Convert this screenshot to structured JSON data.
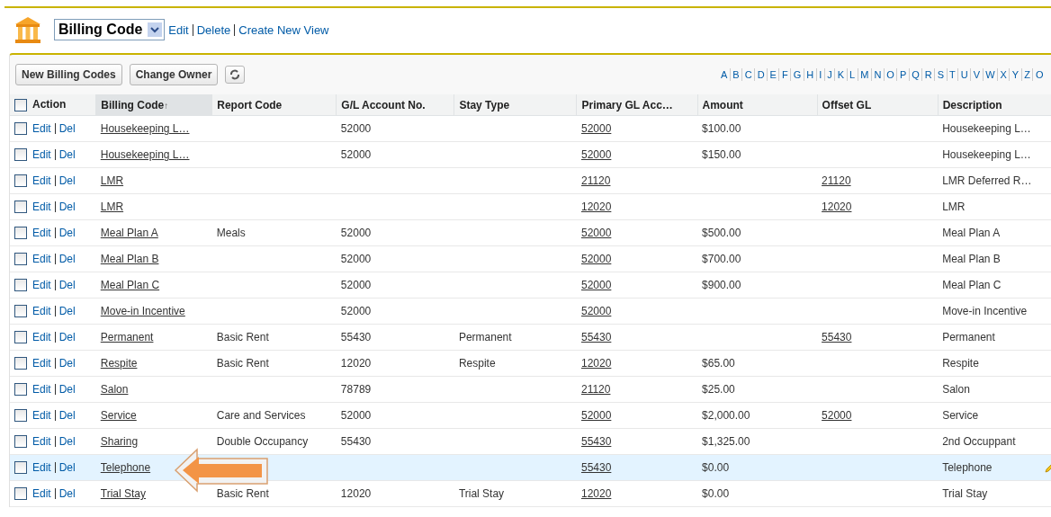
{
  "view": {
    "selected_view": "Billing Code",
    "links": [
      "Edit",
      "Delete",
      "Create New View"
    ]
  },
  "toolbar": {
    "buttons": [
      "New Billing Codes",
      "Change Owner"
    ],
    "alphabet": [
      "A",
      "B",
      "C",
      "D",
      "E",
      "F",
      "G",
      "H",
      "I",
      "J",
      "K",
      "L",
      "M",
      "N",
      "O",
      "P",
      "Q",
      "R",
      "S",
      "T",
      "U",
      "V",
      "W",
      "X",
      "Y",
      "Z",
      "O"
    ]
  },
  "table": {
    "action_label": "Action",
    "all_checked": false,
    "sort_mark": "↑",
    "columns": [
      {
        "label": "Billing Code",
        "kind": "link",
        "sorted": true
      },
      {
        "label": "Report Code",
        "kind": "text",
        "sorted": false
      },
      {
        "label": "G/L Account No.",
        "kind": "text",
        "sorted": false
      },
      {
        "label": "Stay Type",
        "kind": "text",
        "sorted": false
      },
      {
        "label": "Primary GL Acc…",
        "kind": "link",
        "sorted": false
      },
      {
        "label": "Amount",
        "kind": "text",
        "sorted": false
      },
      {
        "label": "Offset GL",
        "kind": "link",
        "sorted": false
      },
      {
        "label": "Description",
        "kind": "text",
        "sorted": false
      }
    ],
    "rows": [
      {
        "checked": false,
        "selected": false,
        "actions": [
          "Edit",
          "Del"
        ],
        "cells": [
          "Housekeeping L…",
          "",
          "52000",
          "",
          "52000",
          "$100.00",
          "",
          "Housekeeping L…"
        ]
      },
      {
        "checked": false,
        "selected": false,
        "actions": [
          "Edit",
          "Del"
        ],
        "cells": [
          "Housekeeping L…",
          "",
          "52000",
          "",
          "52000",
          "$150.00",
          "",
          "Housekeeping L…"
        ]
      },
      {
        "checked": false,
        "selected": false,
        "actions": [
          "Edit",
          "Del"
        ],
        "cells": [
          "LMR",
          "",
          "",
          "",
          "21120",
          "",
          "21120",
          "LMR Deferred R…"
        ]
      },
      {
        "checked": false,
        "selected": false,
        "actions": [
          "Edit",
          "Del"
        ],
        "cells": [
          "LMR",
          "",
          "",
          "",
          "12020",
          "",
          "12020",
          "LMR"
        ]
      },
      {
        "checked": false,
        "selected": false,
        "actions": [
          "Edit",
          "Del"
        ],
        "cells": [
          "Meal Plan A",
          "Meals",
          "52000",
          "",
          "52000",
          "$500.00",
          "",
          "Meal Plan A"
        ]
      },
      {
        "checked": false,
        "selected": false,
        "actions": [
          "Edit",
          "Del"
        ],
        "cells": [
          "Meal Plan B",
          "",
          "52000",
          "",
          "52000",
          "$700.00",
          "",
          "Meal Plan B"
        ]
      },
      {
        "checked": false,
        "selected": false,
        "actions": [
          "Edit",
          "Del"
        ],
        "cells": [
          "Meal Plan C",
          "",
          "52000",
          "",
          "52000",
          "$900.00",
          "",
          "Meal Plan C"
        ]
      },
      {
        "checked": false,
        "selected": false,
        "actions": [
          "Edit",
          "Del"
        ],
        "cells": [
          "Move-in Incentive",
          "",
          "52000",
          "",
          "52000",
          "",
          "",
          "Move-in Incentive"
        ]
      },
      {
        "checked": false,
        "selected": false,
        "actions": [
          "Edit",
          "Del"
        ],
        "cells": [
          "Permanent",
          "Basic Rent",
          "55430",
          "Permanent",
          "55430",
          "",
          "55430",
          "Permanent"
        ]
      },
      {
        "checked": false,
        "selected": false,
        "actions": [
          "Edit",
          "Del"
        ],
        "cells": [
          "Respite",
          "Basic Rent",
          "12020",
          "Respite",
          "12020",
          "$65.00",
          "",
          "Respite"
        ]
      },
      {
        "checked": false,
        "selected": false,
        "actions": [
          "Edit",
          "Del"
        ],
        "cells": [
          "Salon",
          "",
          "78789",
          "",
          "21120",
          "$25.00",
          "",
          "Salon"
        ]
      },
      {
        "checked": false,
        "selected": false,
        "actions": [
          "Edit",
          "Del"
        ],
        "cells": [
          "Service",
          "Care and Services",
          "52000",
          "",
          "52000",
          "$2,000.00",
          "52000",
          "Service"
        ]
      },
      {
        "checked": false,
        "selected": false,
        "actions": [
          "Edit",
          "Del"
        ],
        "cells": [
          "Sharing",
          "Double Occupancy",
          "55430",
          "",
          "55430",
          "$1,325.00",
          "",
          "2nd Occuppant"
        ]
      },
      {
        "checked": false,
        "selected": true,
        "actions": [
          "Edit",
          "Del"
        ],
        "cells": [
          "Telephone",
          "",
          "",
          "",
          "55430",
          "$0.00",
          "",
          "Telephone"
        ]
      },
      {
        "checked": false,
        "selected": false,
        "actions": [
          "Edit",
          "Del"
        ],
        "cells": [
          "Trial Stay",
          "Basic Rent",
          "12020",
          "Trial Stay",
          "12020",
          "$0.00",
          "",
          "Trial Stay"
        ]
      }
    ]
  }
}
